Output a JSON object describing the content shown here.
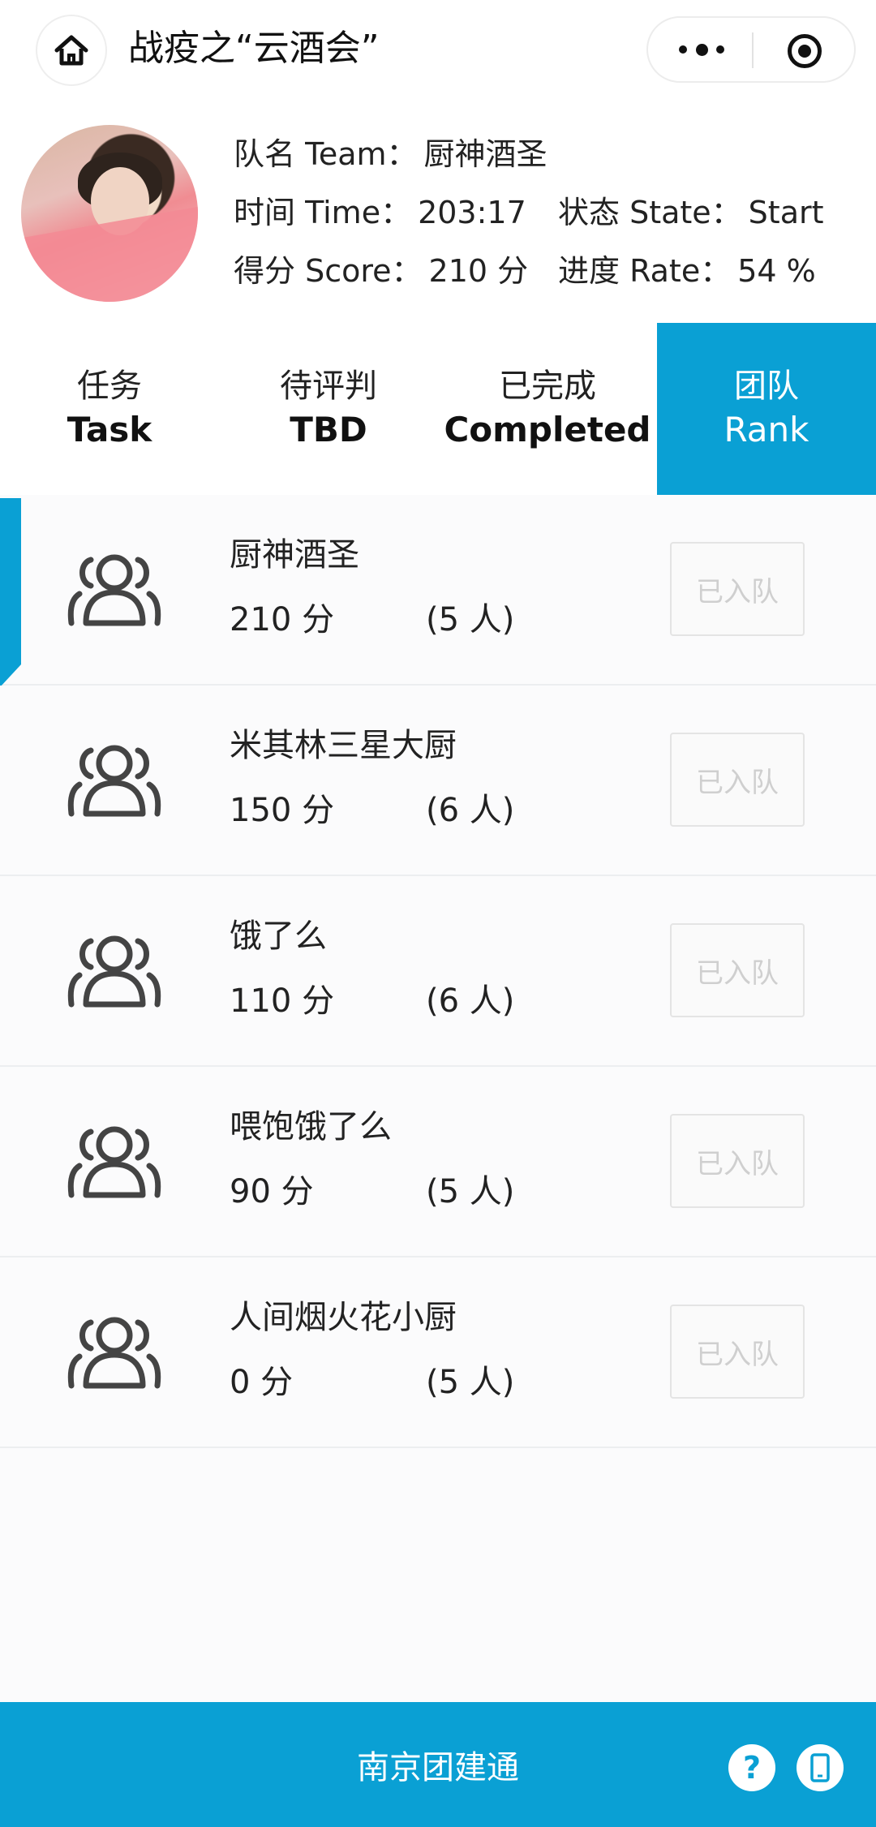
{
  "header": {
    "title": "战疫之“云酒会”",
    "icons": {
      "home": "home-icon",
      "more": "more-dots-icon",
      "close": "close-ring-icon"
    }
  },
  "profile": {
    "team_label": "队名 Team：",
    "team_value": "厨神酒圣",
    "time_label": "时间 Time：",
    "time_value": "203:17",
    "state_label": "状态 State：",
    "state_value": "Start",
    "score_label": "得分 Score：",
    "score_value": "210 分",
    "rate_label": "进度 Rate：",
    "rate_value": "54 %"
  },
  "tabs": [
    {
      "cn": "任务",
      "en": "Task",
      "active": false
    },
    {
      "cn": "待评判",
      "en": "TBD",
      "active": false
    },
    {
      "cn": "已完成",
      "en": "Completed",
      "active": false
    },
    {
      "cn": "团队",
      "en": "Rank",
      "active": true
    }
  ],
  "teams": [
    {
      "name": "厨神酒圣",
      "score": "210 分",
      "members": "(5 人)",
      "button": "已入队",
      "current": true
    },
    {
      "name": "米其林三星大厨",
      "score": "150 分",
      "members": "(6 人)",
      "button": "已入队",
      "current": false
    },
    {
      "name": "饿了么",
      "score": "110 分",
      "members": "(6 人)",
      "button": "已入队",
      "current": false
    },
    {
      "name": "喂饱饿了么",
      "score": "90 分",
      "members": "(5 人)",
      "button": "已入队",
      "current": false
    },
    {
      "name": "人间烟火花小厨",
      "score": "0 分",
      "members": "(5 人)",
      "button": "已入队",
      "current": false
    }
  ],
  "footer": {
    "brand": "南京团建通",
    "help_label": "?",
    "icons": {
      "help": "help-icon",
      "phone": "phone-icon"
    }
  },
  "colors": {
    "accent": "#0aa0d4",
    "text": "#222222",
    "disabled": "#cfcfcf"
  }
}
